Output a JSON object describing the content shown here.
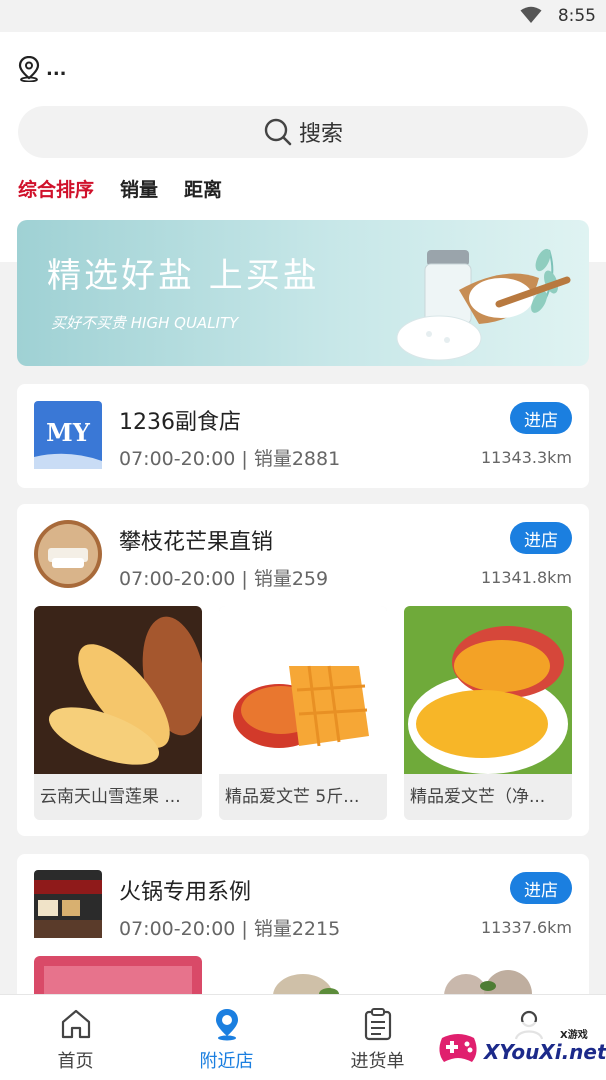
{
  "status_bar": {
    "time": "8:55",
    "wifi_icon": "wifi-icon"
  },
  "location": {
    "text": "...",
    "icon": "location-pin-icon"
  },
  "search": {
    "placeholder": "搜索",
    "icon": "search-icon"
  },
  "sort_tabs": [
    {
      "label": "综合排序",
      "active": true
    },
    {
      "label": "销量",
      "active": false
    },
    {
      "label": "距离",
      "active": false
    }
  ],
  "banner": {
    "title": "精选好盐 上买盐",
    "subtitle": "买好不买贵 HIGH QUALITY"
  },
  "stores": [
    {
      "name": "1236副食店",
      "meta": "07:00-20:00 | 销量2881",
      "distance": "11343.3km",
      "enter_label": "进店",
      "logo_text": "MY"
    },
    {
      "name": "攀枝花芒果直销",
      "meta": "07:00-20:00 | 销量259",
      "distance": "11341.8km",
      "enter_label": "进店",
      "products": [
        {
          "name": "云南天山雪莲果 ..."
        },
        {
          "name": "精品爱文芒 5斤..."
        },
        {
          "name": "精品爱文芒（净..."
        }
      ]
    },
    {
      "name": "火锅专用系例",
      "meta": "07:00-20:00 | 销量2215",
      "distance": "11337.6km",
      "enter_label": "进店"
    }
  ],
  "tabbar": [
    {
      "label": "首页",
      "icon": "home-icon",
      "active": false
    },
    {
      "label": "附近店",
      "icon": "nearby-location-icon",
      "active": true
    },
    {
      "label": "进货单",
      "icon": "clipboard-icon",
      "active": false
    },
    {
      "label": "",
      "icon": "user-icon",
      "active": false
    }
  ],
  "watermark": {
    "small": "X游戏",
    "text": "XYouXi.net"
  },
  "colors": {
    "accent": "#1b7fe0",
    "sort_active": "#d0112b",
    "background": "#f2f2f2"
  }
}
